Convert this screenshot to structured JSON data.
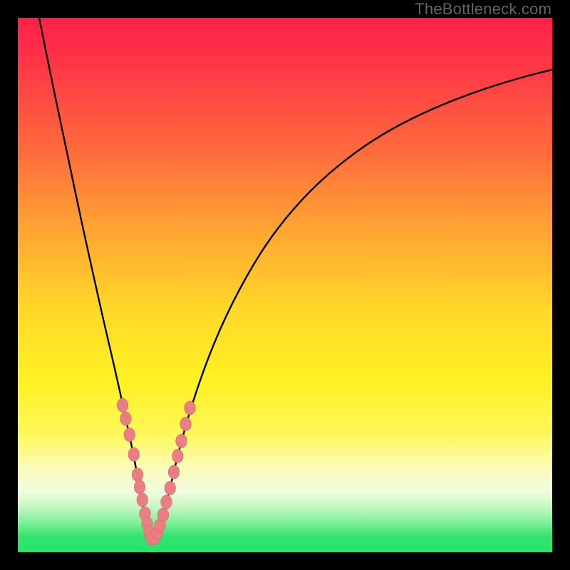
{
  "watermark": "TheBottleneck.com",
  "colors": {
    "frame": "#000000",
    "curve": "#000000",
    "beads_fill": "#e97f83",
    "beads_stroke": "#d36a6f",
    "green_band": "#29e26b",
    "gradient_stops": [
      {
        "offset": 0.0,
        "color": "#ff1f4a"
      },
      {
        "offset": 0.1,
        "color": "#ff3a47"
      },
      {
        "offset": 0.25,
        "color": "#ff6b3c"
      },
      {
        "offset": 0.4,
        "color": "#ffa632"
      },
      {
        "offset": 0.55,
        "color": "#ffd928"
      },
      {
        "offset": 0.68,
        "color": "#fff123"
      },
      {
        "offset": 0.78,
        "color": "#fdf85b"
      },
      {
        "offset": 0.84,
        "color": "#fbfcb6"
      },
      {
        "offset": 0.885,
        "color": "#f2fce0"
      },
      {
        "offset": 0.915,
        "color": "#c7f7c4"
      },
      {
        "offset": 0.945,
        "color": "#7ef097"
      },
      {
        "offset": 0.97,
        "color": "#34e371"
      },
      {
        "offset": 1.0,
        "color": "#29e26b"
      }
    ]
  },
  "chart_data": {
    "type": "line",
    "title": "",
    "xlabel": "",
    "ylabel": "",
    "xlim": [
      0,
      100
    ],
    "ylim": [
      0,
      100
    ],
    "notch_x": 25,
    "series": [
      {
        "name": "bottleneck-curve",
        "points": [
          {
            "x": 4.0,
            "y": 100.0
          },
          {
            "x": 6.0,
            "y": 90.0
          },
          {
            "x": 8.0,
            "y": 80.5
          },
          {
            "x": 10.0,
            "y": 71.0
          },
          {
            "x": 12.0,
            "y": 61.5
          },
          {
            "x": 14.0,
            "y": 52.5
          },
          {
            "x": 16.0,
            "y": 43.5
          },
          {
            "x": 18.0,
            "y": 35.0
          },
          {
            "x": 20.0,
            "y": 26.0
          },
          {
            "x": 21.5,
            "y": 19.0
          },
          {
            "x": 23.0,
            "y": 11.0
          },
          {
            "x": 24.0,
            "y": 5.0
          },
          {
            "x": 25.0,
            "y": 2.3
          },
          {
            "x": 26.0,
            "y": 3.0
          },
          {
            "x": 27.0,
            "y": 6.2
          },
          {
            "x": 28.5,
            "y": 12.0
          },
          {
            "x": 30.0,
            "y": 18.5
          },
          {
            "x": 32.5,
            "y": 27.5
          },
          {
            "x": 36.0,
            "y": 37.5
          },
          {
            "x": 40.0,
            "y": 46.5
          },
          {
            "x": 45.0,
            "y": 55.5
          },
          {
            "x": 50.0,
            "y": 62.5
          },
          {
            "x": 56.0,
            "y": 69.0
          },
          {
            "x": 63.0,
            "y": 74.8
          },
          {
            "x": 70.0,
            "y": 79.3
          },
          {
            "x": 78.0,
            "y": 83.2
          },
          {
            "x": 86.0,
            "y": 86.3
          },
          {
            "x": 94.0,
            "y": 88.8
          },
          {
            "x": 100.0,
            "y": 90.3
          }
        ]
      }
    ],
    "beads_left": [
      {
        "x": 19.6,
        "y": 27.5
      },
      {
        "x": 20.2,
        "y": 25.0
      },
      {
        "x": 20.9,
        "y": 22.0
      },
      {
        "x": 21.7,
        "y": 18.3
      },
      {
        "x": 22.4,
        "y": 14.5
      },
      {
        "x": 22.8,
        "y": 12.2
      },
      {
        "x": 23.3,
        "y": 9.8
      },
      {
        "x": 23.8,
        "y": 7.2
      },
      {
        "x": 24.2,
        "y": 5.3
      },
      {
        "x": 24.6,
        "y": 3.7
      },
      {
        "x": 25.0,
        "y": 2.6
      }
    ],
    "beads_right": [
      {
        "x": 25.6,
        "y": 2.7
      },
      {
        "x": 26.1,
        "y": 3.6
      },
      {
        "x": 26.6,
        "y": 5.0
      },
      {
        "x": 27.2,
        "y": 7.0
      },
      {
        "x": 27.8,
        "y": 9.4
      },
      {
        "x": 28.5,
        "y": 12.0
      },
      {
        "x": 29.2,
        "y": 15.0
      },
      {
        "x": 29.9,
        "y": 18.0
      },
      {
        "x": 30.6,
        "y": 20.8
      },
      {
        "x": 31.4,
        "y": 24.0
      },
      {
        "x": 32.2,
        "y": 27.0
      }
    ]
  }
}
